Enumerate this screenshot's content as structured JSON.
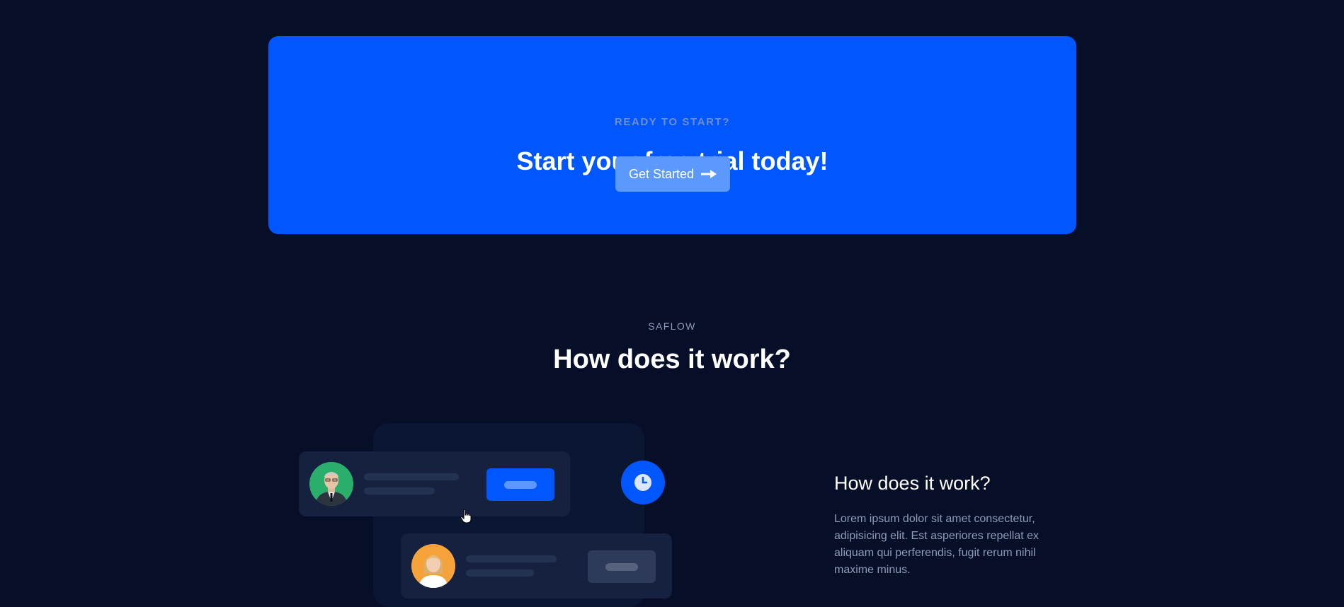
{
  "cta": {
    "eyebrow": "READY TO START?",
    "title": "Start your free trial today!",
    "button_label": "Get Started",
    "button_icon": "arrow-right-icon"
  },
  "section": {
    "eyebrow": "SAFLOW",
    "title": "How does it work?"
  },
  "illustration": {
    "icons": [
      "avatar-man",
      "avatar-woman",
      "clock-icon",
      "hand-cursor-icon"
    ]
  },
  "work": {
    "title": "How does it work?",
    "text": "Lorem ipsum dolor sit amet consectetur, adipisicing elit. Est asperiores repellat ex aliquam qui perferendis, fugit rerum nihil maxime minus."
  },
  "colors": {
    "background": "#070f28",
    "accent": "#0057ff",
    "button": "#5b99ff",
    "card": "#15213f",
    "muted_text": "#8e9ab8"
  }
}
